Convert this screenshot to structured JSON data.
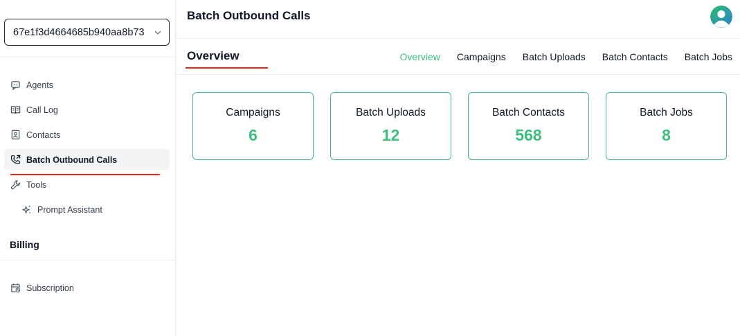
{
  "sidebar": {
    "org_id": "67e1f3d4664685b940aa8b73",
    "items": [
      {
        "label": "Agents",
        "icon": "agent-chat-icon"
      },
      {
        "label": "Call Log",
        "icon": "book-icon"
      },
      {
        "label": "Contacts",
        "icon": "contact-card-icon"
      },
      {
        "label": "Batch Outbound Calls",
        "icon": "phone-outgoing-icon"
      },
      {
        "label": "Tools",
        "icon": "wrench-icon"
      },
      {
        "label": "Prompt Assistant",
        "icon": "sparkles-icon"
      }
    ],
    "billing_title": "Billing",
    "billing_items": [
      {
        "label": "Subscription",
        "icon": "calendar-clock-icon"
      }
    ]
  },
  "header": {
    "title": "Batch Outbound Calls"
  },
  "subheader": {
    "title": "Overview",
    "tabs": [
      "Overview",
      "Campaigns",
      "Batch Uploads",
      "Batch Contacts",
      "Batch Jobs"
    ]
  },
  "stats": [
    {
      "label": "Campaigns",
      "value": "6"
    },
    {
      "label": "Batch Uploads",
      "value": "12"
    },
    {
      "label": "Batch Contacts",
      "value": "568"
    },
    {
      "label": "Batch Jobs",
      "value": "8"
    }
  ],
  "colors": {
    "accent": "#3fbf7f",
    "underline": "#e5281e"
  }
}
